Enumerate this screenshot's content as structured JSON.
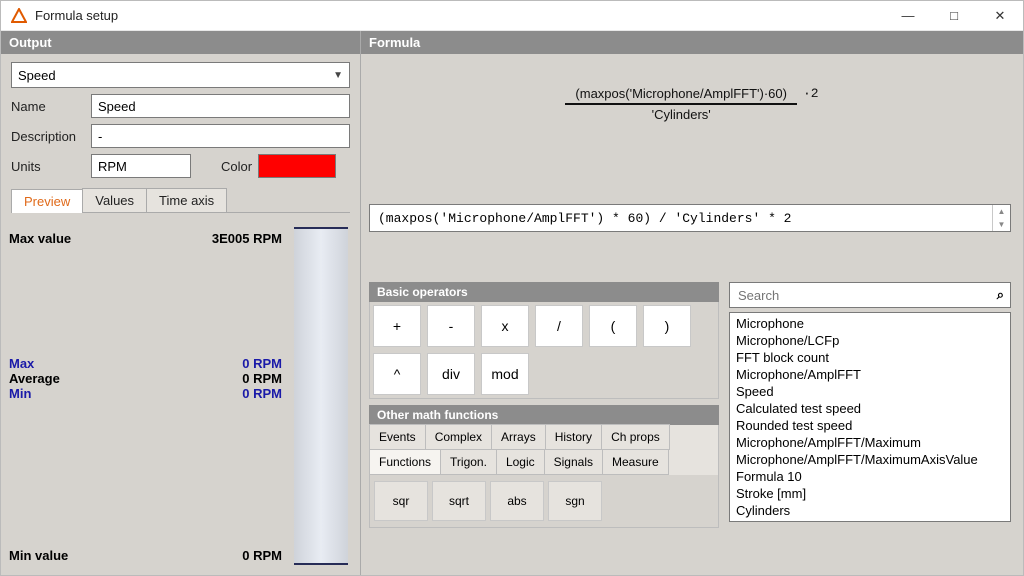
{
  "window": {
    "title": "Formula setup"
  },
  "winctrl": {
    "min": "—",
    "max": "□",
    "close": "✕"
  },
  "headers": {
    "output": "Output",
    "formula": "Formula",
    "basic_ops": "Basic operators",
    "other_fn": "Other math functions"
  },
  "output": {
    "selected": "Speed",
    "name_label": "Name",
    "name_value": "Speed",
    "desc_label": "Description",
    "desc_value": "-",
    "units_label": "Units",
    "units_value": "RPM",
    "color_label": "Color",
    "color_hex": "#ff0000"
  },
  "tabs": {
    "preview": "Preview",
    "values": "Values",
    "timeaxis": "Time axis"
  },
  "preview": {
    "max_value_label": "Max value",
    "max_value": "3E005 RPM",
    "min_value_label": "Min value",
    "min_value": "0 RPM",
    "stats": {
      "max_label": "Max",
      "max_value": "0 RPM",
      "avg_label": "Average",
      "avg_value": "0 RPM",
      "min_label": "Min",
      "min_value": "0 RPM"
    }
  },
  "formula": {
    "numerator": "(maxpos('Microphone/AmplFFT')·60)",
    "denominator": "'Cylinders'",
    "suffix": "·2",
    "text": "(maxpos('Microphone/AmplFFT') * 60) / 'Cylinders' * 2"
  },
  "operators": {
    "r1": [
      "+",
      "-",
      "x",
      "/"
    ],
    "r2": [
      "(",
      ")",
      "^",
      "div",
      "mod"
    ]
  },
  "fn_tabs_row1": [
    "Events",
    "Complex",
    "Arrays",
    "History",
    "Ch props"
  ],
  "fn_tabs_row2": [
    "Functions",
    "Trigon.",
    "Logic",
    "Signals",
    "Measure"
  ],
  "fn_buttons": [
    "sqr",
    "sqrt",
    "abs",
    "sgn"
  ],
  "search": {
    "placeholder": "Search",
    "items": [
      "Microphone",
      "Microphone/LCFp",
      "FFT block count",
      "Microphone/AmplFFT",
      "Speed",
      "Calculated test speed",
      "Rounded test speed",
      "Microphone/AmplFFT/Maximum",
      "Microphone/AmplFFT/MaximumAxisValue",
      "Formula 10",
      "Stroke [mm]",
      "Cylinders"
    ]
  }
}
